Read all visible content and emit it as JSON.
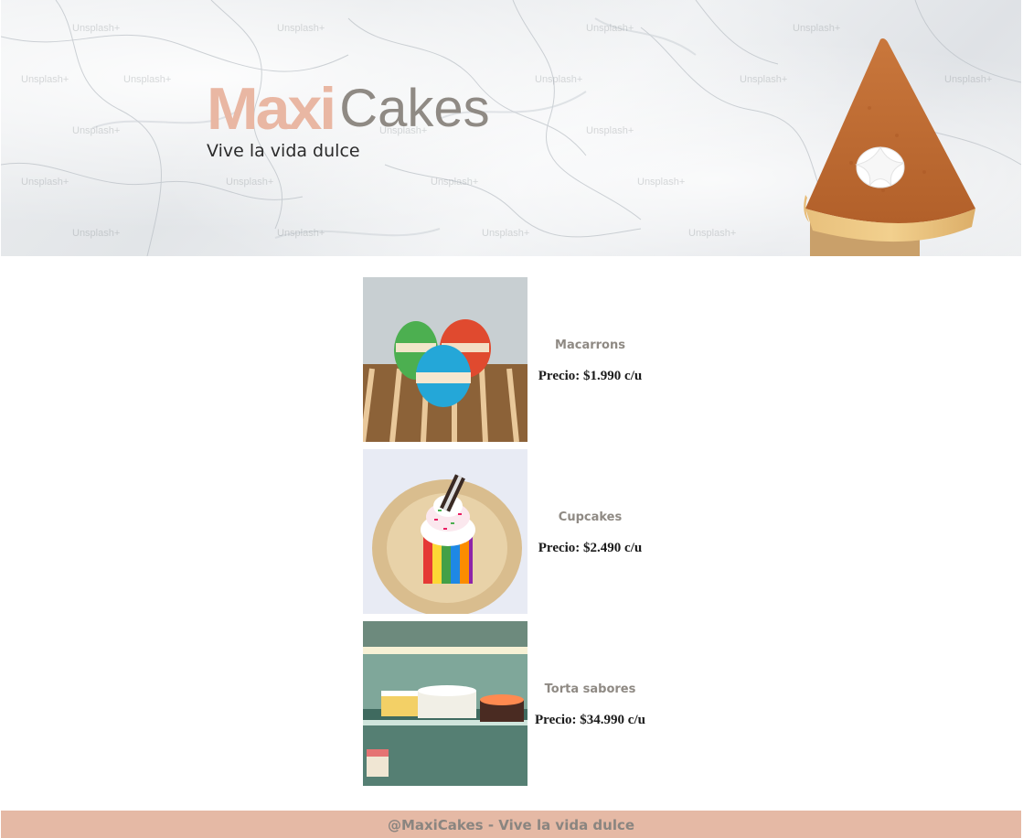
{
  "brand": {
    "name_part1": "Maxi",
    "name_part2": "Cakes",
    "tagline": "Vive la vida dulce",
    "colors": {
      "accent": "#e9b7a3",
      "secondary": "#8f8a84",
      "footer_bg": "#e5b9a5"
    }
  },
  "header": {
    "watermark_text": "Unsplash+",
    "hero_image": "pumpkin-pie-slice-image"
  },
  "products": [
    {
      "name": "Macarrons",
      "price": "Precio: $1.990 c/u",
      "image": "macarons-image"
    },
    {
      "name": "Cupcakes",
      "price": "Precio: $2.490 c/u",
      "image": "cupcake-image"
    },
    {
      "name": "Torta sabores",
      "price": "Precio: $34.990 c/u",
      "image": "cakes-display-image"
    }
  ],
  "footer": {
    "text": "@MaxiCakes - Vive la vida dulce"
  }
}
